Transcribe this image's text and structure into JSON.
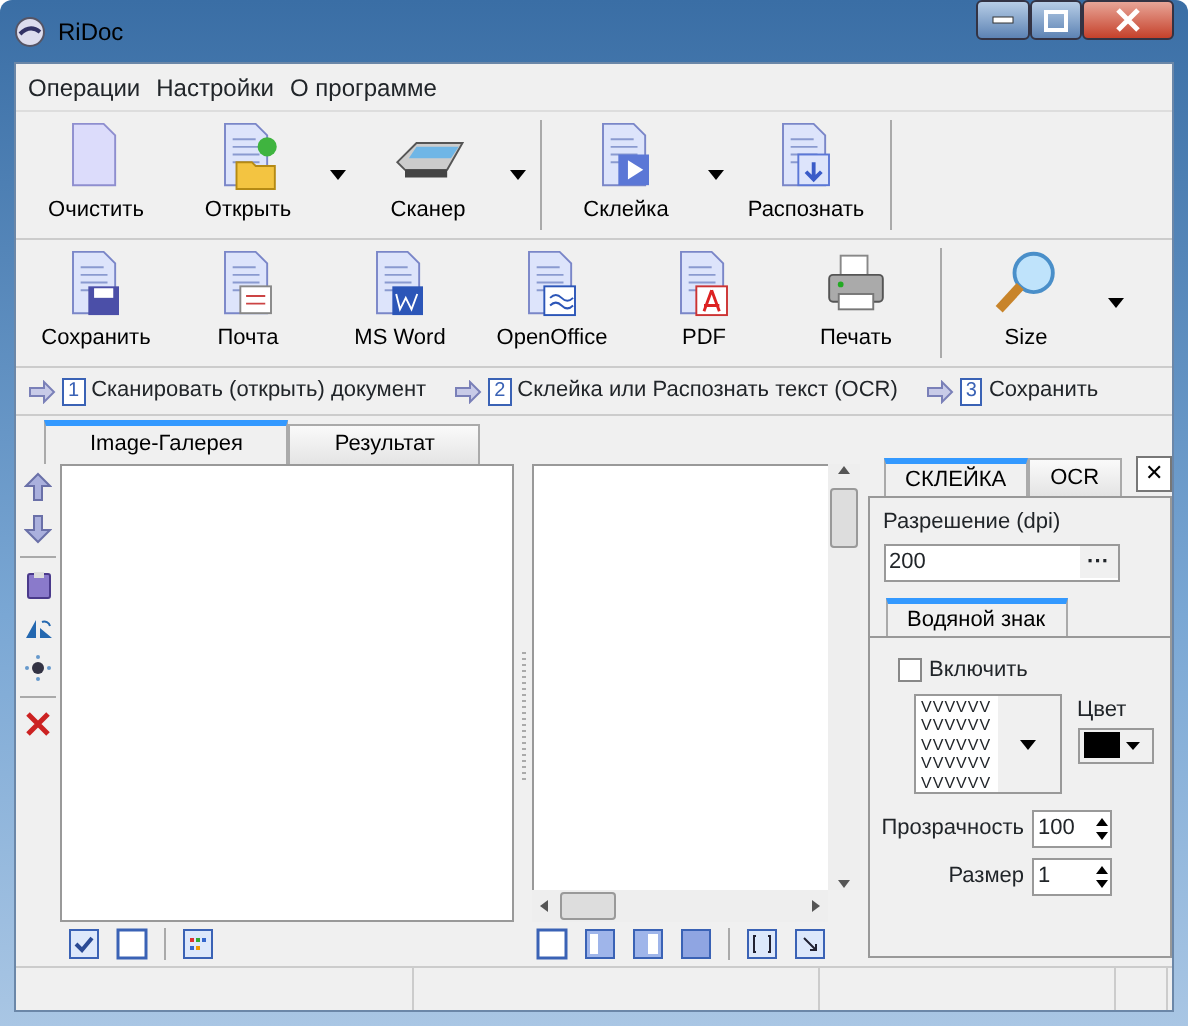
{
  "window": {
    "title": "RiDoc"
  },
  "menu": [
    "Операции",
    "Настройки",
    "О программе"
  ],
  "toolbar_1": [
    {
      "label": "Очистить",
      "dropdown": false,
      "separator_after": false
    },
    {
      "label": "Открыть",
      "dropdown": true,
      "separator_after": false
    },
    {
      "label": "Сканер",
      "dropdown": true,
      "separator_after": true
    },
    {
      "label": "Склейка",
      "dropdown": true,
      "separator_after": false
    },
    {
      "label": "Распознать",
      "dropdown": false,
      "separator_after": true
    }
  ],
  "toolbar_2": [
    {
      "label": "Сохранить",
      "dropdown": false,
      "separator_after": false
    },
    {
      "label": "Почта",
      "dropdown": false,
      "separator_after": false
    },
    {
      "label": "MS Word",
      "dropdown": false,
      "separator_after": false
    },
    {
      "label": "OpenOffice",
      "dropdown": false,
      "separator_after": false
    },
    {
      "label": "PDF",
      "dropdown": false,
      "separator_after": false
    },
    {
      "label": "Печать",
      "dropdown": false,
      "separator_after": true
    },
    {
      "label": "Size",
      "dropdown": true,
      "separator_after": false
    }
  ],
  "steps": [
    {
      "number": "1",
      "text": "Сканировать (открыть) документ"
    },
    {
      "number": "2",
      "text": "Склейка или Распознать текст (OCR)"
    },
    {
      "number": "3",
      "text": "Сохранить"
    }
  ],
  "tabs": [
    {
      "label": "Image-Галерея",
      "selected": true
    },
    {
      "label": "Результат",
      "selected": false
    }
  ],
  "bottom_left_toolbar": [
    {
      "kind": "check"
    },
    {
      "kind": "uncheck"
    },
    {
      "kind": "grid"
    }
  ],
  "panel": {
    "tabs": [
      {
        "label": "СКЛЕЙКА",
        "selected": true
      },
      {
        "label": "OCR",
        "selected": false
      }
    ],
    "close": "✕",
    "resolution": {
      "label": "Разрешение (dpi)",
      "value": "200",
      "button": "···"
    },
    "inner_tab": {
      "label": "Водяной знак",
      "selected": true
    },
    "enable": {
      "label": "Включить",
      "checked": false
    },
    "pattern": [
      "VVVVVV",
      "VVVVVV",
      "VVVVVV",
      "VVVVVV",
      "VVVVVV"
    ],
    "color": {
      "label": "Цвет",
      "color": "#000000"
    },
    "transparency": {
      "label": "Прозрачность",
      "value": "100"
    },
    "size": {
      "label": "Размер",
      "value": "1"
    }
  }
}
